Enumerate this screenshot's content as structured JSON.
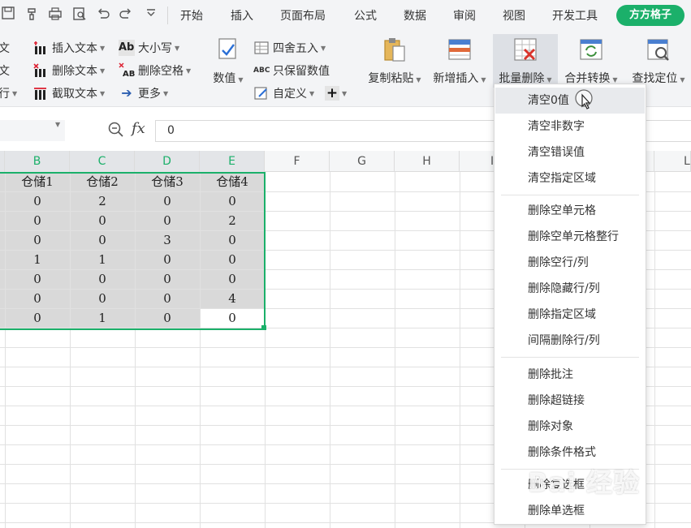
{
  "menubar": {
    "tabs": [
      "开始",
      "插入",
      "页面布局",
      "公式",
      "数据",
      "审阅",
      "视图",
      "开发工具"
    ],
    "brand_button": "方方格子",
    "quick_access_icons": [
      "save-icon",
      "format-painter-icon",
      "print-icon",
      "print-preview-icon",
      "undo-icon",
      "redo-icon",
      "customize-icon"
    ]
  },
  "ribbon": {
    "left_cut_glyphs": [
      "文",
      "文",
      "行"
    ],
    "text_group": {
      "insert_text": "插入文本",
      "delete_text": "删除文本",
      "extract_text": "截取文本",
      "case": "大小写",
      "delete_spaces": "删除空格",
      "more": "更多"
    },
    "number_group": {
      "numeric": "数值",
      "round": "四舍五入",
      "keep_values": "只保留数值",
      "custom": "自定义",
      "plus": "+"
    },
    "big_buttons": {
      "copy_paste": "复制粘贴",
      "add_insert": "新增插入",
      "batch_delete": "批量删除",
      "merge_convert": "合并转换",
      "find_locate": "查找定位"
    }
  },
  "formula_bar": {
    "fx": "fx",
    "value": "0"
  },
  "sheet": {
    "columns": [
      "B",
      "C",
      "D",
      "E",
      "F",
      "G",
      "H",
      "I",
      "L"
    ],
    "headers": [
      "仓储1",
      "仓储2",
      "仓储3",
      "仓储4"
    ],
    "rows": [
      [
        "0",
        "2",
        "0",
        "0"
      ],
      [
        "0",
        "0",
        "0",
        "2"
      ],
      [
        "0",
        "0",
        "3",
        "0"
      ],
      [
        "1",
        "1",
        "0",
        "0"
      ],
      [
        "0",
        "0",
        "0",
        "0"
      ],
      [
        "0",
        "0",
        "0",
        "4"
      ],
      [
        "0",
        "1",
        "0",
        "0"
      ]
    ]
  },
  "dropdown": {
    "groups": [
      [
        "清空0值",
        "清空非数字",
        "清空错误值",
        "清空指定区域"
      ],
      [
        "删除空单元格",
        "删除空单元格整行",
        "删除空行/列",
        "删除隐藏行/列",
        "删除指定区域",
        "间隔删除行/列"
      ],
      [
        "删除批注",
        "删除超链接",
        "删除对象",
        "删除条件格式"
      ],
      [
        "删除复选框",
        "删除单选框"
      ]
    ],
    "highlighted": "清空0值"
  },
  "watermark": "Bai 经验",
  "colors": {
    "accent": "#1bb06a",
    "ribbon_bg": "#f3f4f6",
    "selection_shade": "#d9d9d9"
  }
}
